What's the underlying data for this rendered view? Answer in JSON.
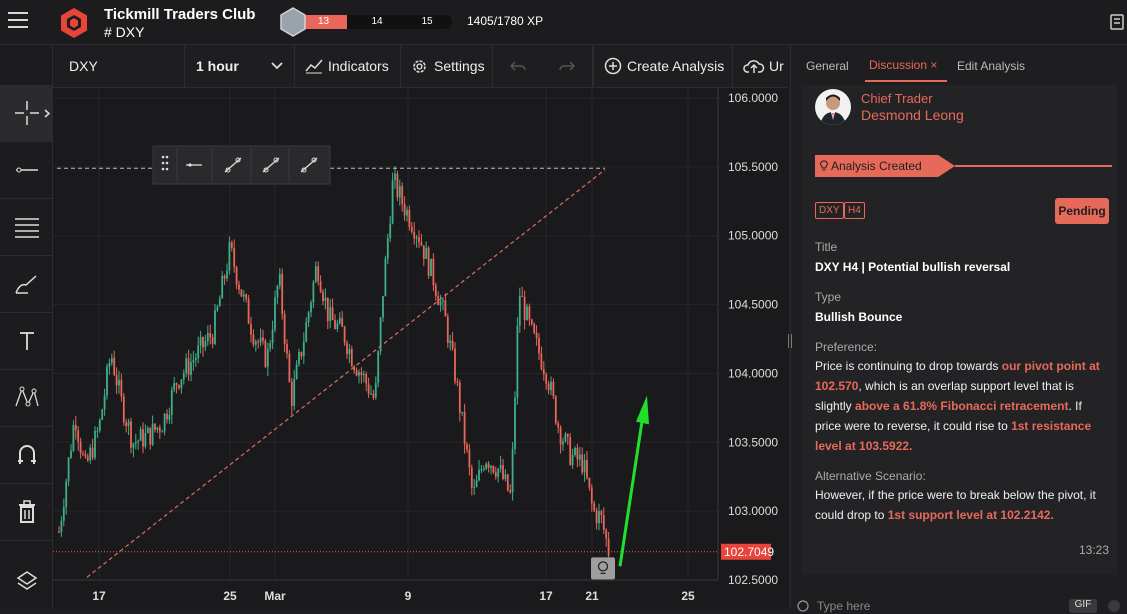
{
  "header": {
    "club_title": "Tickmill Traders Club",
    "club_sub": "# DXY",
    "xp_levels": [
      "13",
      "14",
      "15"
    ],
    "xp_text": "1405/1780 XP"
  },
  "toolbar": {
    "symbol": "DXY",
    "timeframe": "1 hour",
    "indicators": "Indicators",
    "settings": "Settings",
    "create_analysis": "Create Analysis",
    "upload_cut": "Ur"
  },
  "chart": {
    "y_ticks": [
      "106.0000",
      "105.5000",
      "105.0000",
      "104.5000",
      "104.0000",
      "103.5000",
      "103.0000",
      "102.5000"
    ],
    "x_ticks": [
      "17",
      "25",
      "Mar",
      "9",
      "17",
      "21",
      "25"
    ],
    "current_price": "102.7049"
  },
  "panel": {
    "tabs": [
      "General",
      "Discussion",
      "Edit Analysis"
    ],
    "trader_role": "Chief Trader",
    "trader_name": "Desmond Leong",
    "status_label": "Analysis Created",
    "tags": [
      "DXY",
      "H4"
    ],
    "pending": "Pending",
    "title_label": "Title",
    "title_value": "DXY H4 | Potential bullish reversal",
    "type_label": "Type",
    "type_value": "Bullish Bounce",
    "pref_label": "Preference:",
    "pref_1": "Price is continuing to drop towards ",
    "pref_hl1": "our pivot point at 102.570",
    "pref_2": ", which is an overlap support level that is slightly ",
    "pref_hl2": "above a 61.8% Fibonacci retracement",
    "pref_3": ". If price were to reverse, it could rise to ",
    "pref_hl3": "1st resistance level at 103.5922.",
    "alt_label": "Alternative Scenario:",
    "alt_1": "However, if the price were to break below the pivot, it could drop to ",
    "alt_hl": "1st support level at 102.2142.",
    "time": "13:23",
    "type_here": "Type here",
    "gif": "GIF"
  },
  "colors": {
    "accent": "#e66a5a",
    "up": "#3fae8a",
    "down": "#e8665a"
  }
}
